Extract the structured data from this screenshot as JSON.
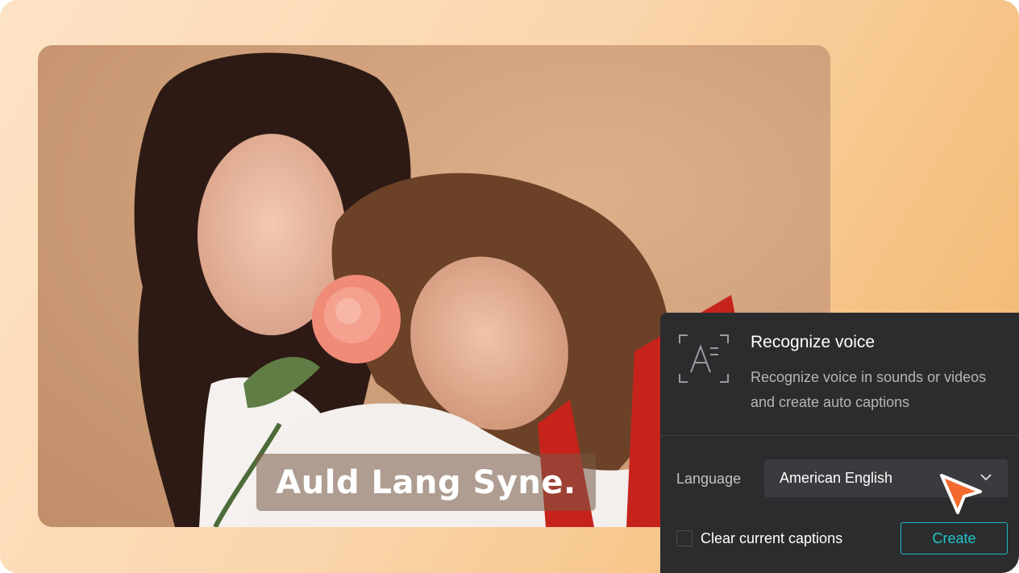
{
  "video": {
    "caption": "Auld Lang Syne."
  },
  "panel": {
    "icon": "auto-caption-icon",
    "title": "Recognize voice",
    "description": "Recognize voice in sounds or videos and create auto captions",
    "language_label": "Language",
    "language_value": "American English",
    "clear_captions_label": "Clear current captions",
    "clear_captions_checked": false,
    "create_label": "Create"
  },
  "colors": {
    "accent": "#22c5cd",
    "panel_bg": "#2b2c2e",
    "cursor": "#f26a2e"
  }
}
